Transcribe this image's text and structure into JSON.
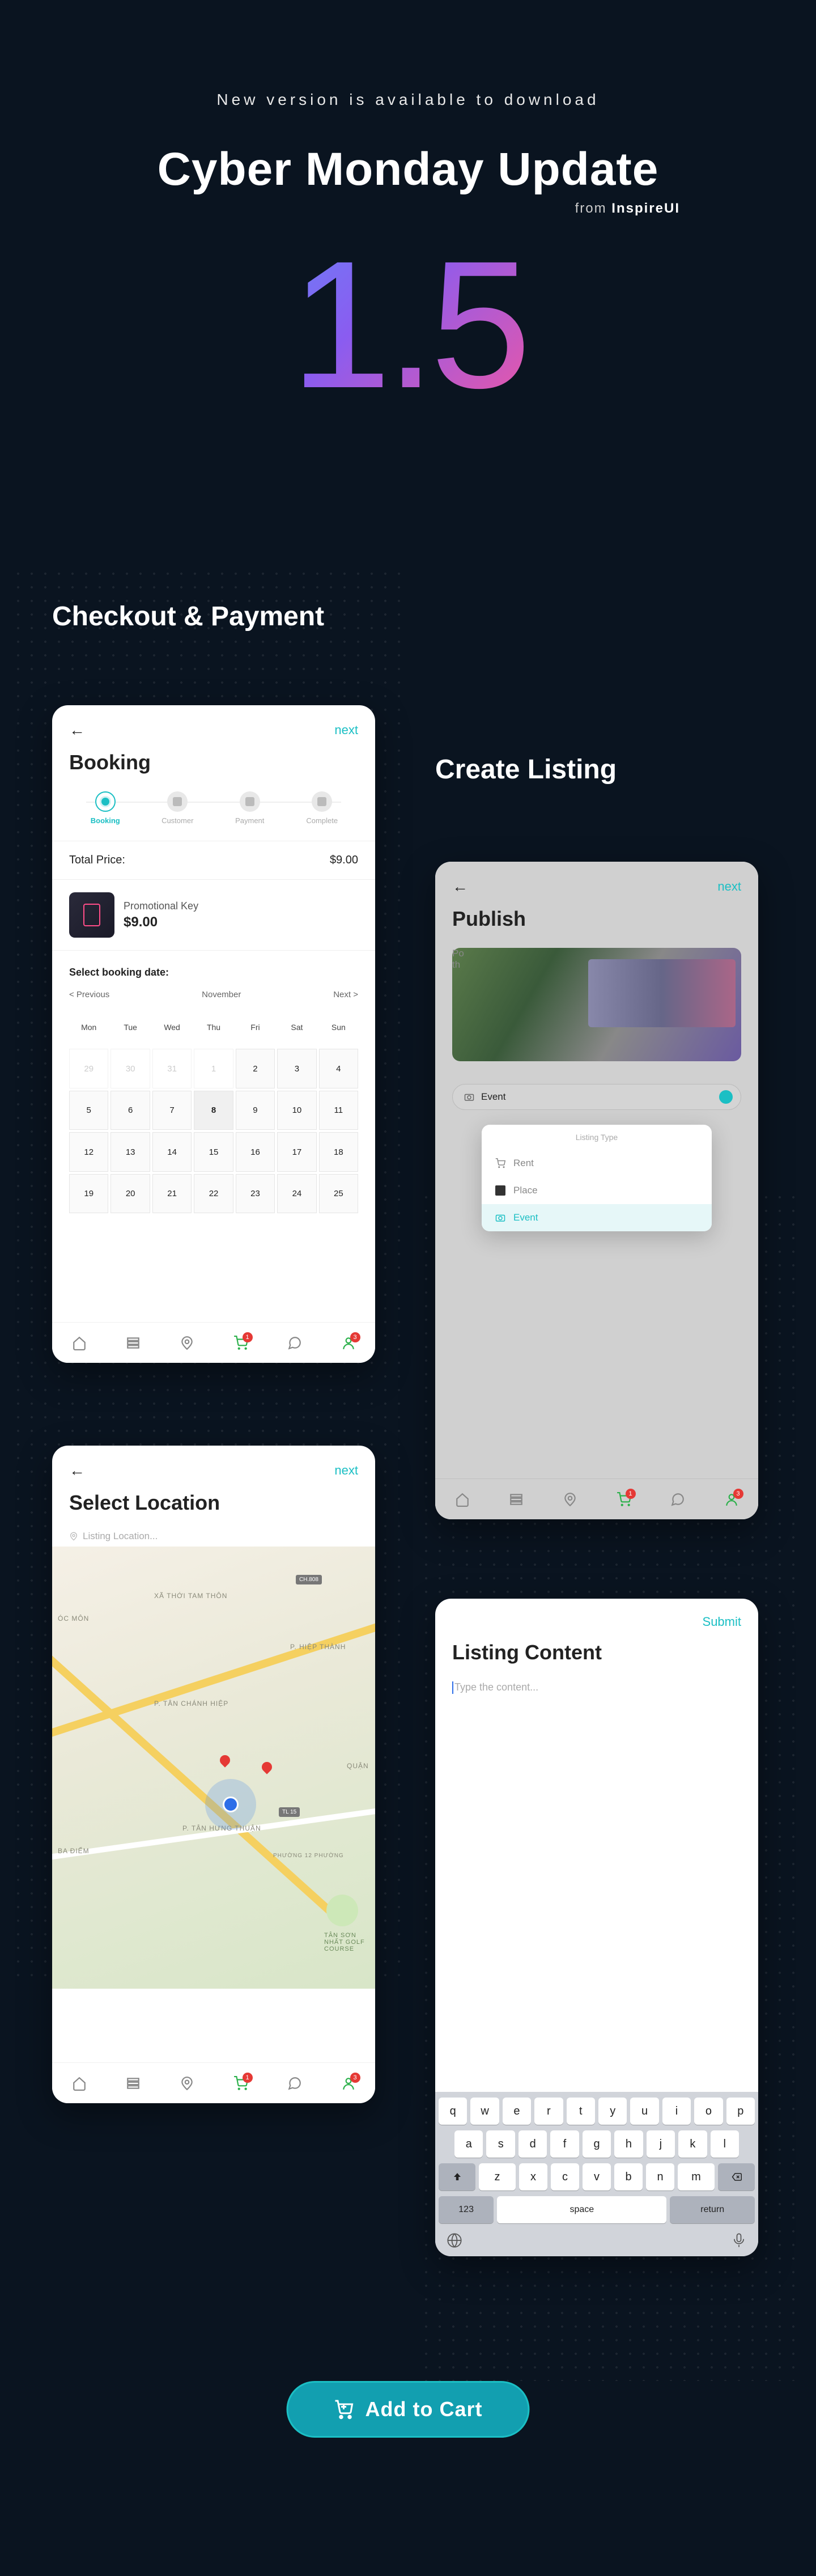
{
  "hero": {
    "subtitle": "New version is available to download",
    "title": "Cyber Monday Update",
    "from_prefix": "from",
    "from_brand": "InspireUI",
    "version": "1.5"
  },
  "sections": {
    "checkout": "Checkout & Payment",
    "create": "Create Listing"
  },
  "booking": {
    "next": "next",
    "title": "Booking",
    "steps": [
      "Booking",
      "Customer",
      "Payment",
      "Complete"
    ],
    "total_label": "Total Price:",
    "total_value": "$9.00",
    "product_name": "Promotional Key",
    "product_price": "$9.00",
    "date_label": "Select booking date:",
    "cal_prev": "< Previous",
    "cal_month": "November",
    "cal_next": "Next >",
    "cal_days": [
      "Mon",
      "Tue",
      "Wed",
      "Thu",
      "Fri",
      "Sat",
      "Sun"
    ],
    "cal_cells": [
      {
        "v": "29",
        "m": true
      },
      {
        "v": "30",
        "m": true
      },
      {
        "v": "31",
        "m": true
      },
      {
        "v": "1",
        "m": true
      },
      {
        "v": "2"
      },
      {
        "v": "3"
      },
      {
        "v": "4"
      },
      {
        "v": "5"
      },
      {
        "v": "6"
      },
      {
        "v": "7"
      },
      {
        "v": "8",
        "sel": true
      },
      {
        "v": "9"
      },
      {
        "v": "10"
      },
      {
        "v": "11"
      },
      {
        "v": "12"
      },
      {
        "v": "13"
      },
      {
        "v": "14"
      },
      {
        "v": "15"
      },
      {
        "v": "16"
      },
      {
        "v": "17"
      },
      {
        "v": "18"
      },
      {
        "v": "19"
      },
      {
        "v": "20"
      },
      {
        "v": "21"
      },
      {
        "v": "22"
      },
      {
        "v": "23"
      },
      {
        "v": "24"
      },
      {
        "v": "25"
      }
    ],
    "nav_badges": {
      "cart": "1",
      "profile": "3"
    }
  },
  "location": {
    "next": "next",
    "title": "Select Location",
    "search_placeholder": "Listing Location...",
    "labels": [
      "ÓC MÔN",
      "XÃ THỚI TAM THÔN",
      "P. HIỆP THÀNH",
      "P. TÂN CHÁNH HIỆP",
      "P. TÂN HƯNG THUẬN",
      "BA ĐIỂM",
      "QUẬN",
      "PHƯỜNG 12 PHƯỜNG"
    ],
    "routes": [
      "CH.808",
      "TL 15"
    ],
    "poi": "Tân Sơn Nhất Golf Course",
    "nav_badges": {
      "cart": "1",
      "profile": "3"
    }
  },
  "publish": {
    "next": "next",
    "title": "Publish",
    "popup_title": "Listing Type",
    "options": [
      "Rent",
      "Place",
      "Event"
    ],
    "selected": "Event",
    "faded_line1": "Po",
    "faded_line2": "th",
    "nav_badges": {
      "cart": "1",
      "profile": "3"
    }
  },
  "content": {
    "submit": "Submit",
    "title": "Listing Content",
    "placeholder": "Type the content...",
    "keys_r1": [
      "q",
      "w",
      "e",
      "r",
      "t",
      "y",
      "u",
      "i",
      "o",
      "p"
    ],
    "keys_r2": [
      "a",
      "s",
      "d",
      "f",
      "g",
      "h",
      "j",
      "k",
      "l"
    ],
    "keys_r3": [
      "z",
      "x",
      "c",
      "v",
      "b",
      "n",
      "m"
    ],
    "key_123": "123",
    "key_space": "space",
    "key_return": "return"
  },
  "cta": {
    "label": "Add to Cart"
  }
}
